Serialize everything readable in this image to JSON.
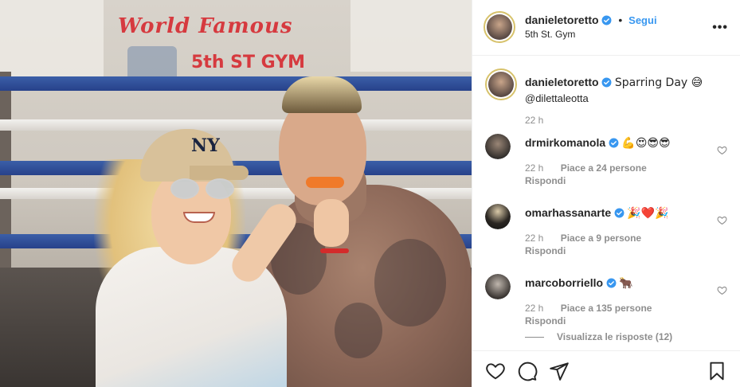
{
  "header": {
    "username": "danieletoretto",
    "separator": "•",
    "follow_label": "Segui",
    "location": "5th St. Gym",
    "more_icon": "more-icon"
  },
  "photo": {
    "sign_line1": "World Famous",
    "sign_line2": "5th ST GYM",
    "cap_logo": "NY"
  },
  "caption": {
    "username": "danieletoretto",
    "text": "Sparring Day 😅",
    "mention": "@dilettaleotta",
    "time": "22 h"
  },
  "comments": [
    {
      "username": "drmirkomanola",
      "text": "💪😍😎😎",
      "time": "22 h",
      "likes": "Piace a 24 persone",
      "reply": "Rispondi"
    },
    {
      "username": "omarhassanarte",
      "text": "🎉❤️🎉",
      "time": "22 h",
      "likes": "Piace a 9 persone",
      "reply": "Rispondi"
    },
    {
      "username": "marcoborriello",
      "text": "🐂",
      "time": "22 h",
      "likes": "Piace a 135 persone",
      "reply": "Rispondi"
    }
  ],
  "view_replies": "Visualizza le risposte (12)",
  "colors": {
    "accent": "#3897f0",
    "secondary_text": "#8e8e8e",
    "border": "#efefef"
  },
  "icons": [
    "heart-icon",
    "comment-icon",
    "share-icon",
    "bookmark-icon",
    "verified-icon"
  ]
}
